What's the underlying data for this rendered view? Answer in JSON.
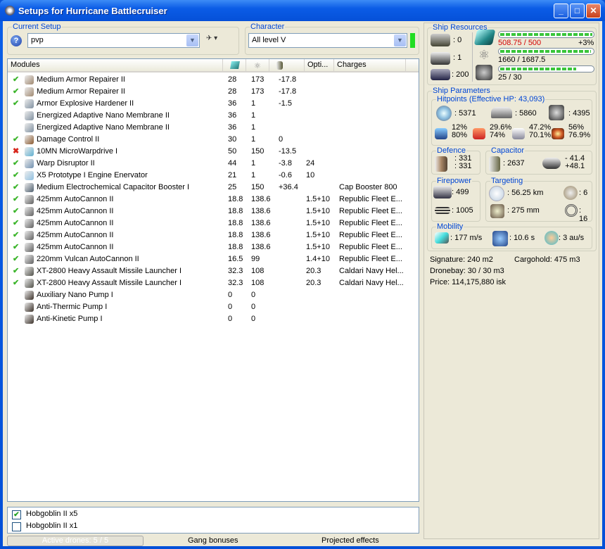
{
  "window": {
    "title": "Setups for Hurricane Battlecruiser",
    "min": "_",
    "max": "□",
    "close": "✕"
  },
  "setup": {
    "label": "Current Setup",
    "value": "pvp"
  },
  "character": {
    "label": "Character",
    "value": "All level V",
    "status_color": "#22dd22"
  },
  "modules": {
    "columns": [
      "Modules",
      "",
      "",
      "",
      "Opti...",
      "Charges"
    ],
    "rows": [
      {
        "status": "on",
        "name": "Medium Armor Repairer II",
        "pg": "28",
        "cpu": "173",
        "cap": "-17.8",
        "opt": "",
        "charge": "",
        "icon": "#a08870"
      },
      {
        "status": "on",
        "name": "Medium Armor Repairer II",
        "pg": "28",
        "cpu": "173",
        "cap": "-17.8",
        "opt": "",
        "charge": "",
        "icon": "#a08870"
      },
      {
        "status": "on",
        "name": "Armor Explosive Hardener II",
        "pg": "36",
        "cpu": "1",
        "cap": "-1.5",
        "opt": "",
        "charge": "",
        "icon": "#8090a0"
      },
      {
        "status": "",
        "name": "Energized Adaptive Nano Membrane II",
        "pg": "36",
        "cpu": "1",
        "cap": "",
        "opt": "",
        "charge": "",
        "icon": "#8090a0"
      },
      {
        "status": "",
        "name": "Energized Adaptive Nano Membrane II",
        "pg": "36",
        "cpu": "1",
        "cap": "",
        "opt": "",
        "charge": "",
        "icon": "#8090a0"
      },
      {
        "status": "on",
        "name": "Damage Control II",
        "pg": "30",
        "cpu": "1",
        "cap": "0",
        "opt": "",
        "charge": "",
        "icon": "#8a5a30"
      },
      {
        "status": "off",
        "name": "10MN MicroWarpdrive I",
        "pg": "50",
        "cpu": "150",
        "cap": "-13.5",
        "opt": "",
        "charge": "",
        "icon": "#60b0d0"
      },
      {
        "status": "on",
        "name": "Warp Disruptor II",
        "pg": "44",
        "cpu": "1",
        "cap": "-3.8",
        "opt": "24",
        "charge": "",
        "icon": "#7090b0"
      },
      {
        "status": "on",
        "name": "X5 Prototype I Engine Enervator",
        "pg": "21",
        "cpu": "1",
        "cap": "-0.6",
        "opt": "10",
        "charge": "",
        "icon": "#90c0e0"
      },
      {
        "status": "on",
        "name": "Medium Electrochemical Capacitor Booster I",
        "pg": "25",
        "cpu": "150",
        "cap": "+36.4",
        "opt": "",
        "charge": "Cap Booster 800",
        "icon": "#506070"
      },
      {
        "status": "on",
        "name": "425mm AutoCannon II",
        "pg": "18.8",
        "cpu": "138.6",
        "cap": "",
        "opt": "1.5+10",
        "charge": "Republic Fleet E...",
        "icon": "#606060"
      },
      {
        "status": "on",
        "name": "425mm AutoCannon II",
        "pg": "18.8",
        "cpu": "138.6",
        "cap": "",
        "opt": "1.5+10",
        "charge": "Republic Fleet E...",
        "icon": "#606060"
      },
      {
        "status": "on",
        "name": "425mm AutoCannon II",
        "pg": "18.8",
        "cpu": "138.6",
        "cap": "",
        "opt": "1.5+10",
        "charge": "Republic Fleet E...",
        "icon": "#606060"
      },
      {
        "status": "on",
        "name": "425mm AutoCannon II",
        "pg": "18.8",
        "cpu": "138.6",
        "cap": "",
        "opt": "1.5+10",
        "charge": "Republic Fleet E...",
        "icon": "#606060"
      },
      {
        "status": "on",
        "name": "425mm AutoCannon II",
        "pg": "18.8",
        "cpu": "138.6",
        "cap": "",
        "opt": "1.5+10",
        "charge": "Republic Fleet E...",
        "icon": "#606060"
      },
      {
        "status": "on",
        "name": "220mm Vulcan AutoCannon II",
        "pg": "16.5",
        "cpu": "99",
        "cap": "",
        "opt": "1.4+10",
        "charge": "Republic Fleet E...",
        "icon": "#606060"
      },
      {
        "status": "on",
        "name": "XT-2800 Heavy Assault Missile Launcher I",
        "pg": "32.3",
        "cpu": "108",
        "cap": "",
        "opt": "20.3",
        "charge": "Caldari Navy Hel...",
        "icon": "#505048"
      },
      {
        "status": "on",
        "name": "XT-2800 Heavy Assault Missile Launcher I",
        "pg": "32.3",
        "cpu": "108",
        "cap": "",
        "opt": "20.3",
        "charge": "Caldari Navy Hel...",
        "icon": "#505048"
      },
      {
        "status": "",
        "name": "Auxiliary Nano Pump I",
        "pg": "0",
        "cpu": "0",
        "cap": "",
        "opt": "",
        "charge": "",
        "icon": "#3a3028"
      },
      {
        "status": "",
        "name": "Anti-Thermic Pump I",
        "pg": "0",
        "cpu": "0",
        "cap": "",
        "opt": "",
        "charge": "",
        "icon": "#3a3028"
      },
      {
        "status": "",
        "name": "Anti-Kinetic Pump I",
        "pg": "0",
        "cpu": "0",
        "cap": "",
        "opt": "",
        "charge": "",
        "icon": "#3a3028"
      }
    ]
  },
  "drones": [
    {
      "name": "Hobgoblin II x5",
      "checked": true
    },
    {
      "name": "Hobgoblin II x1",
      "checked": false
    }
  ],
  "bottom": {
    "active_drones": "Active drones: 5 / 5",
    "gang": "Gang bonuses",
    "projected": "Projected effects"
  },
  "resources": {
    "label": "Ship Resources",
    "turrets": ": 0",
    "launchers": ": 1",
    "drone_bw": ": 200",
    "cpu": {
      "text": "508.75 / 500",
      "extra": "+3%",
      "fraction": 1.0
    },
    "pg": {
      "text": "1660 / 1687.5",
      "fraction": 0.984
    },
    "calib": {
      "text": "25 / 30",
      "fraction": 0.833
    }
  },
  "params": {
    "label": "Ship Parameters",
    "hp": {
      "label": "Hitpoints (Effective HP: 43,093)",
      "shield": ": 5371",
      "armor": ": 5860",
      "structure": ": 4395",
      "res": [
        [
          "12%",
          "80%"
        ],
        [
          "29.6%",
          "74%"
        ],
        [
          "47.2%",
          "70.1%"
        ],
        [
          "56%",
          "76.9%"
        ]
      ]
    },
    "defence": {
      "label": "Defence",
      "a": ": 331",
      "b": ": 331"
    },
    "capacitor": {
      "label": "Capacitor",
      "cap": ": 2637",
      "use": "- 41.4",
      "recharge": "+48.1"
    },
    "firepower": {
      "label": "Firepower",
      "turret": ": 499",
      "missile": ": 1005"
    },
    "targeting": {
      "label": "Targeting",
      "range": ": 56.25 km",
      "targets": ": 6",
      "res": ": 275 mm",
      "sensor": ": 16"
    },
    "mobility": {
      "label": "Mobility",
      "speed": ": 177 m/s",
      "align": ": 10.6 s",
      "warp": ": 3 au/s"
    }
  },
  "info": {
    "signature": "Signature: 240 m2",
    "cargo": "Cargohold: 475 m3",
    "dronebay": "Dronebay: 30 / 30 m3",
    "price": "Price: 114,175,880 isk"
  }
}
